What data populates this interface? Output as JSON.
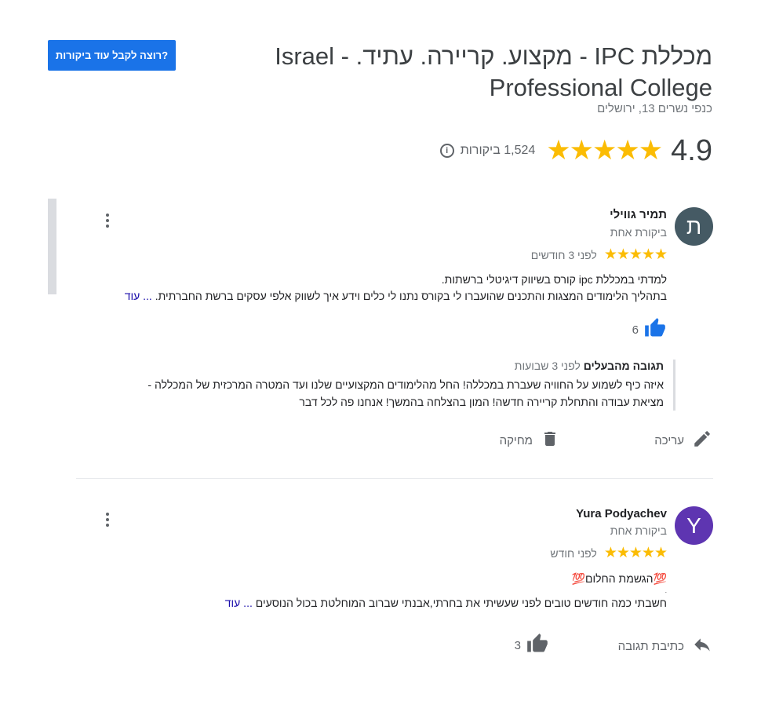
{
  "header": {
    "cta_label": "רוצה לקבל עוד ביקורות?",
    "title": "מכללת IPC - מקצוע. קריירה. עתיד. - Israel Professional College",
    "address": "כנפי נשרים 13, ירושלים",
    "rating": "4.9",
    "stars": "★★★★★",
    "review_count": "1,524 ביקורות",
    "info_glyph": "i"
  },
  "reviews": [
    {
      "avatar_letter": "ת",
      "avatar_color": "#455a64",
      "name": "תמיר גווילי",
      "sub": "ביקורת אחת",
      "stars": "★★★★★",
      "time": "לפני 3 חודשים",
      "line1": "למדתי במכללת ipc קורס בשיווק דיגיטלי ברשתות.",
      "line2": "בתהליך הלימודים המצגות והתכנים שהועברו לי בקורס נתנו לי כלים וידע איך לשווק אלפי עסקים ברשת החברתית.",
      "more": "... עוד",
      "likes": "6",
      "owner_reply": {
        "label": "תגובה מהבעלים",
        "time": "לפני 3 שבועות",
        "line1": "איזה כיף לשמוע על החוויה שעברת במכללה! החל מהלימודים המקצועיים שלנו ועד המטרה המרכזית של המכללה -",
        "line2": "מציאת עבודה והתחלת קריירה חדשה! המון בהצלחה בהמשך! אנחנו פה לכל דבר"
      },
      "edit_label": "עריכה",
      "delete_label": "מחיקה"
    },
    {
      "avatar_letter": "Y",
      "avatar_color": "#5e35b1",
      "name": "Yura Podyachev",
      "sub": "ביקורת אחת",
      "stars": "★★★★★",
      "time": "לפני חודש",
      "line1": "💯הגשמת החלום💯",
      "line_dot": ".",
      "line2": "חשבתי כמה חודשים טובים לפני שעשיתי את בחרתי,אבנתי שברוב המוחלטת בכול הנוסעים",
      "more": "... עוד",
      "likes": "3",
      "reply_label": "כתיבת תגובה"
    }
  ]
}
